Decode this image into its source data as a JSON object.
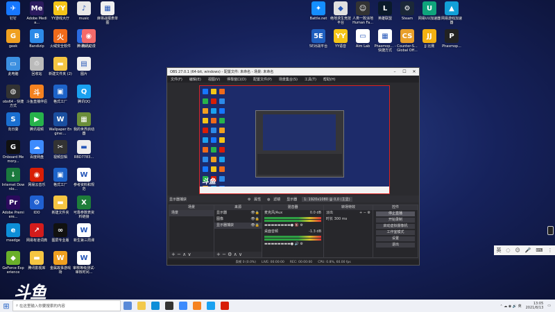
{
  "desktop_left": [
    {
      "label": "钉钉",
      "color": "#1677ff",
      "glyph": "✈",
      "col": 0,
      "row": 0
    },
    {
      "label": "Adobe Media...",
      "color": "#2b1b5e",
      "glyph": "Me",
      "col": 1,
      "row": 0
    },
    {
      "label": "YY游戏大厅",
      "color": "#f5c518",
      "glyph": "YY",
      "col": 2,
      "row": 0
    },
    {
      "label": "music",
      "color": "#e8e8e8",
      "glyph": "♪",
      "col": 3,
      "row": 0
    },
    {
      "label": "麻将战报表单图",
      "color": "#f0f0f0",
      "glyph": "▦",
      "col": 4,
      "row": 0
    },
    {
      "label": "geek",
      "color": "#f0a020",
      "glyph": "G",
      "col": 0,
      "row": 1
    },
    {
      "label": "Bandizip",
      "color": "#2d8ae8",
      "glyph": "B",
      "col": 1,
      "row": 1
    },
    {
      "label": "火绒安全软件",
      "color": "#f06a1a",
      "glyph": "火",
      "col": 2,
      "row": 1
    },
    {
      "label": "腾讯会议",
      "color": "#2b6be0",
      "glyph": "◎",
      "col": 3,
      "row": 1
    },
    {
      "label": "腾讯动漫",
      "color": "#f46a6a",
      "glyph": "◉",
      "col": 3.2,
      "row": 1
    },
    {
      "label": "此电脑",
      "color": "#3b8fe0",
      "glyph": "▭",
      "col": 0,
      "row": 2
    },
    {
      "label": "回收站",
      "color": "#bbb",
      "glyph": "♲",
      "col": 1,
      "row": 2
    },
    {
      "label": "新建文件夹 (2)",
      "color": "#f5c542",
      "glyph": "▬",
      "col": 2,
      "row": 2
    },
    {
      "label": "图片",
      "color": "#f0f0f0",
      "glyph": "▤",
      "col": 3,
      "row": 2
    },
    {
      "label": "obs64 - 快捷方式",
      "color": "#333",
      "glyph": "◍",
      "col": 0,
      "row": 3
    },
    {
      "label": "斗鱼直播伴侣",
      "color": "#f58220",
      "glyph": "斗",
      "col": 1,
      "row": 3
    },
    {
      "label": "格式工厂",
      "color": "#1d63c9",
      "glyph": "▣",
      "col": 2,
      "row": 3
    },
    {
      "label": "腾讯QQ",
      "color": "#1aa1f0",
      "glyph": "Q",
      "col": 3,
      "row": 3
    },
    {
      "label": "向日葵",
      "color": "#1a6fd0",
      "glyph": "S",
      "col": 0,
      "row": 4
    },
    {
      "label": "腾讯视频",
      "color": "#27b34b",
      "glyph": "▶",
      "col": 1,
      "row": 4
    },
    {
      "label": "Wallpaper Engine:...",
      "color": "#1a4fa0",
      "glyph": "W",
      "col": 2,
      "row": 4
    },
    {
      "label": "我的世界启动器",
      "color": "#6b8e3a",
      "glyph": "▦",
      "col": 3,
      "row": 4
    },
    {
      "label": "Onboard Memory...",
      "color": "#111",
      "glyph": "G",
      "col": 0,
      "row": 5
    },
    {
      "label": "百度网盘",
      "color": "#3d8bfd",
      "glyph": "☁",
      "col": 1,
      "row": 5
    },
    {
      "label": "视频剪辑",
      "color": "#333",
      "glyph": "✂",
      "col": 2,
      "row": 5
    },
    {
      "label": "RBD7783...",
      "color": "#eee",
      "glyph": "▬",
      "col": 3,
      "row": 5
    },
    {
      "label": "Internet Downlo...",
      "color": "#1b7a3e",
      "glyph": "↓",
      "col": 0,
      "row": 6
    },
    {
      "label": "网易云音乐",
      "color": "#d81e06",
      "glyph": "◉",
      "col": 1,
      "row": 6
    },
    {
      "label": "格式工厂",
      "color": "#1d63c9",
      "glyph": "▣",
      "col": 2,
      "row": 6
    },
    {
      "label": "参考资料和规范",
      "color": "#fff",
      "glyph": "W",
      "col": 3,
      "row": 6
    },
    {
      "label": "Adobe Premiere...",
      "color": "#2a0a5c",
      "glyph": "Pr",
      "col": 0,
      "row": 7
    },
    {
      "label": "IDO",
      "color": "#2060d0",
      "glyph": "⚙",
      "col": 1,
      "row": 7
    },
    {
      "label": "新建文件夹",
      "color": "#f5c542",
      "glyph": "▬",
      "col": 2,
      "row": 7
    },
    {
      "label": "可靠参数表资料链接",
      "color": "#1e7d3a",
      "glyph": "X",
      "col": 3,
      "row": 7
    },
    {
      "label": "msedge",
      "color": "#0d8ed8",
      "glyph": "e",
      "col": 0,
      "row": 8
    },
    {
      "label": "网易有道词典",
      "color": "#d31c1c",
      "glyph": "↗",
      "col": 1,
      "row": 8
    },
    {
      "label": "图屏专业版",
      "color": "#111",
      "glyph": "∞",
      "col": 2,
      "row": 8
    },
    {
      "label": "新生第三周课",
      "color": "#fff",
      "glyph": "W",
      "col": 3,
      "row": 8
    },
    {
      "label": "GeForce Experience",
      "color": "#6ab02a",
      "glyph": "◆",
      "col": 0,
      "row": 9
    },
    {
      "label": "腾讯影视库",
      "color": "#f5c542",
      "glyph": "▬",
      "col": 1,
      "row": 9
    },
    {
      "label": "金属故事游戏场",
      "color": "#f0a020",
      "glyph": "W",
      "col": 2,
      "row": 9
    },
    {
      "label": "审核等级测试-审核时间...",
      "color": "#fff",
      "glyph": "W",
      "col": 3,
      "row": 9
    }
  ],
  "desktop_right": [
    {
      "label": "Battle.net",
      "color": "#148eff",
      "glyph": "✦"
    },
    {
      "label": "绝地求生竞技平台",
      "color": "#e0e0e0",
      "glyph": "◆"
    },
    {
      "label": "人类一败涂地 Human Fa...",
      "color": "#333",
      "glyph": "☺"
    },
    {
      "label": "英雄联盟",
      "color": "#0a1a2a",
      "glyph": "L"
    },
    {
      "label": "Steam",
      "color": "#1b2838",
      "glyph": "⚙"
    },
    {
      "label": "网易UU加速器",
      "color": "#0fa47c",
      "glyph": "U"
    },
    {
      "label": "网易游戏加速器",
      "color": "#12a0d8",
      "glyph": "▲"
    },
    {
      "label": "5E对战平台",
      "color": "#1f5fbf",
      "glyph": "5E"
    },
    {
      "label": "YY语音",
      "color": "#f5c518",
      "glyph": "YY"
    },
    {
      "label": "Aim Lab",
      "color": "#fff",
      "glyph": "▭"
    },
    {
      "label": "Phasmop... - 快捷方式",
      "color": "#fff",
      "glyph": "▦"
    },
    {
      "label": "Counter-S... Global Off...",
      "color": "#e89f2a",
      "glyph": "CS"
    },
    {
      "label": "JJ 比赛",
      "color": "#f3b112",
      "glyph": "JJ"
    },
    {
      "label": "Phasmop...",
      "color": "#222",
      "glyph": "P"
    }
  ],
  "obs": {
    "title": "OBS 27.0.1 (64-bit, windows) - 配置文件: 未命名 - 场景: 未命名",
    "menu": [
      "文件(F)",
      "编辑(E)",
      "视图(V)",
      "停靠窗口(D)",
      "配置文件(P)",
      "场景集合(S)",
      "工具(T)",
      "帮助(H)"
    ],
    "control_bar": {
      "scene_label": "显示器捕获",
      "properties": "属性",
      "filters": "滤镜",
      "display_label": "显示器",
      "display_value": "1: 1920x1080 @ 0,0 (主显)"
    },
    "docks": {
      "scenes": {
        "title": "场景",
        "items": [
          "场景"
        ]
      },
      "sources": {
        "title": "来源",
        "items": [
          "显示器",
          "图像",
          "显示器捕获"
        ]
      },
      "mixer": {
        "title": "混音器",
        "tracks": [
          {
            "name": "麦克风/Aux",
            "db": "0.0 dB"
          },
          {
            "name": "桌面音频",
            "db": "-1.3 dB"
          }
        ]
      },
      "transitions": {
        "title": "转场特效",
        "type": "淡出",
        "duration_label": "时长",
        "duration": "300 ms"
      },
      "controls": {
        "title": "控件",
        "buttons": [
          "停止直播",
          "开始录制",
          "启动虚拟摄像机",
          "工作室模式",
          "设置",
          "退出"
        ]
      }
    },
    "status": [
      "丢帧 0 (0.0%)",
      "LIVE: 00:00:00",
      "REC: 00:00:00",
      "CPU: 0.8%, 60.00 fps"
    ]
  },
  "taskbar": {
    "search_placeholder": "在这里输入你要搜索的内容",
    "time": "13:05",
    "date": "2021/8/13"
  },
  "ime": {
    "label": "英"
  },
  "watermark": "斗鱼"
}
